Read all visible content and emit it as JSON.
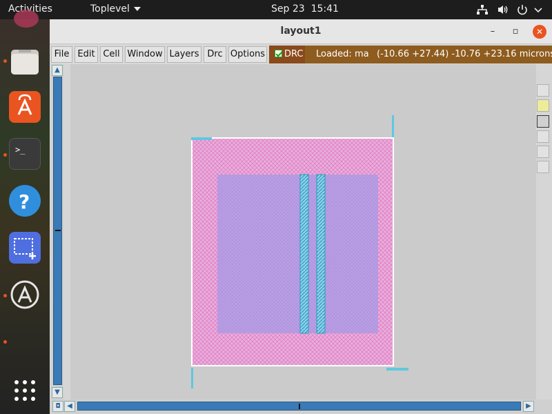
{
  "topbar": {
    "activities": "Activities",
    "app_menu": "Toplevel",
    "date": "Sep 23",
    "time": "15:41",
    "tray_icons": [
      "network-icon",
      "volume-icon",
      "power-icon",
      "chevron-down-icon"
    ]
  },
  "dock": {
    "apps": [
      {
        "name": "files",
        "icon": "folder-icon",
        "running": true
      },
      {
        "name": "app-center",
        "icon": "shopping-bag-icon",
        "running": false
      },
      {
        "name": "terminal",
        "icon": "terminal-icon",
        "running": true
      },
      {
        "name": "help",
        "icon": "help-icon",
        "running": false
      },
      {
        "name": "screenshot",
        "icon": "screenshot-icon",
        "running": false
      },
      {
        "name": "software-updater",
        "icon": "updater-icon",
        "running": true
      }
    ],
    "show_apps_icon": "grid-icon"
  },
  "window": {
    "title": "layout1",
    "controls": {
      "minimize": "–",
      "maximize": "▫",
      "close": "✕"
    }
  },
  "menu": {
    "items": [
      "File",
      "Edit",
      "Cell",
      "Window",
      "Layers",
      "Drc",
      "Options"
    ],
    "drc_toggle_label": "DRC",
    "drc_checked": true
  },
  "status": {
    "loaded": "Loaded: ma",
    "coords": "(-10.66 +27.44) -10.76 +23.16 microns"
  },
  "colors": {
    "status_bg": "#8e5c1e",
    "drc_bg": "#8a4a1c",
    "scroll_track": "#3a7ab6",
    "layer_pink": "#e97fc8",
    "layer_purple": "#a990e8",
    "layer_cyan": "#66cce0",
    "canvas_bg": "#cbcbcb",
    "close_button": "#e95420"
  }
}
